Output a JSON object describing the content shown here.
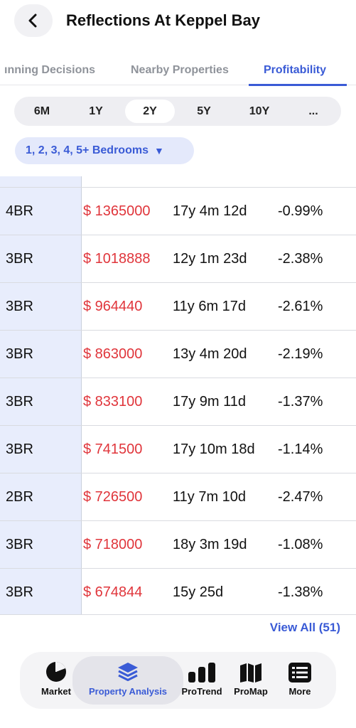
{
  "header": {
    "title": "Reflections At Keppel Bay",
    "back_icon": "chevron-left-icon"
  },
  "tabs": [
    {
      "label": "ınning Decisions",
      "active": false
    },
    {
      "label": "Nearby Properties",
      "active": false
    },
    {
      "label": "Profitability",
      "active": true
    }
  ],
  "periods": {
    "items": [
      "6M",
      "1Y",
      "2Y",
      "5Y",
      "10Y",
      "..."
    ],
    "selected": "2Y"
  },
  "bedroom_filter": {
    "label": "1, 2, 3, 4, 5+ Bedrooms",
    "caret": "▼"
  },
  "table": {
    "rows": [
      {
        "type": "4BR",
        "price": "$ 1365000",
        "duration": "17y 4m 12d",
        "change": "-0.99%"
      },
      {
        "type": "3BR",
        "price": "$ 1018888",
        "duration": "12y 1m 23d",
        "change": "-2.38%"
      },
      {
        "type": "3BR",
        "price": "$ 964440",
        "duration": "11y 6m 17d",
        "change": "-2.61%"
      },
      {
        "type": "3BR",
        "price": "$ 863000",
        "duration": "13y 4m 20d",
        "change": "-2.19%"
      },
      {
        "type": "3BR",
        "price": "$ 833100",
        "duration": "17y 9m 11d",
        "change": "-1.37%"
      },
      {
        "type": "3BR",
        "price": "$ 741500",
        "duration": "17y 10m 18d",
        "change": "-1.14%"
      },
      {
        "type": "2BR",
        "price": "$ 726500",
        "duration": "11y 7m 10d",
        "change": "-2.47%"
      },
      {
        "type": "3BR",
        "price": "$ 718000",
        "duration": "18y 3m 19d",
        "change": "-1.08%"
      },
      {
        "type": "3BR",
        "price": "$ 674844",
        "duration": "15y 25d",
        "change": "-1.38%"
      }
    ]
  },
  "view_all": "View All (51)",
  "bottom_nav": [
    {
      "label": "Market",
      "icon": "pie-chart-icon",
      "active": false
    },
    {
      "label": "Property Analysis",
      "icon": "layers-icon",
      "active": true
    },
    {
      "label": "ProTrend",
      "icon": "bar-chart-icon",
      "active": false
    },
    {
      "label": "ProMap",
      "icon": "map-icon",
      "active": false
    },
    {
      "label": "More",
      "icon": "list-icon",
      "active": false
    }
  ],
  "colors": {
    "accent": "#3a5bd6",
    "price_red": "#e0353b",
    "left_column_bg": "#e8edfc"
  }
}
